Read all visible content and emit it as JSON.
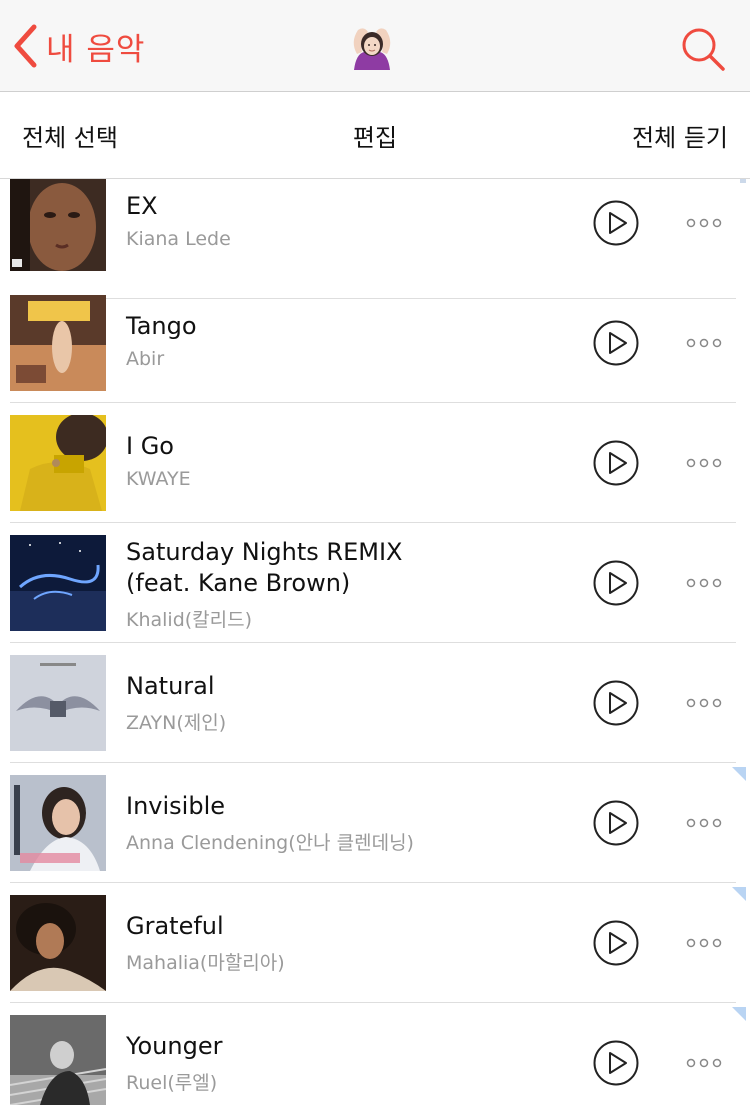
{
  "nav": {
    "back_label": "내 음악",
    "title_icon": "woman-gesturing-ok-emoji",
    "search_icon": "search-icon",
    "accent_color": "#ef4b3f"
  },
  "toolbar": {
    "select_all_label": "전체 선택",
    "edit_label": "편집",
    "play_all_label": "전체 듣기"
  },
  "songs": [
    {
      "title": "EX",
      "artist": "Kiana Lede"
    },
    {
      "title": "Tango",
      "artist": "Abir"
    },
    {
      "title": "I Go",
      "artist": "KWAYE"
    },
    {
      "title": "Saturday Nights REMIX (feat. Kane Brown)",
      "artist": "Khalid(칼리드)"
    },
    {
      "title": "Natural",
      "artist": "ZAYN(제인)"
    },
    {
      "title": "Invisible",
      "artist": "Anna Clendening(안나 클렌데닝)"
    },
    {
      "title": "Grateful",
      "artist": "Mahalia(마할리아)"
    },
    {
      "title": "Younger",
      "artist": "Ruel(루엘)"
    }
  ],
  "row_icons": {
    "play": "play-circle-icon",
    "more": "more-dots-icon"
  }
}
